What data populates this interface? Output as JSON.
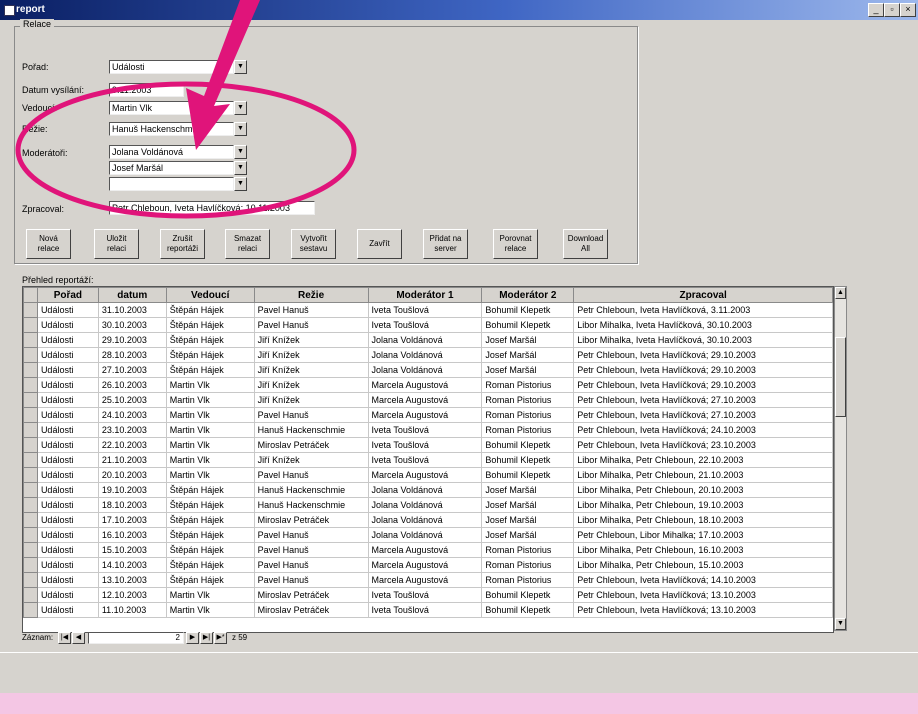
{
  "window": {
    "title": "report",
    "min_label": "_",
    "max_label": "▫",
    "close_label": "×"
  },
  "form": {
    "group_title": "Relace",
    "fields": {
      "porad_label": "Pořad:",
      "porad_value": "Události",
      "datum_label": "Datum vysílání:",
      "datum_value": "9.11.2003",
      "vedouci_label": "Vedoucí:",
      "vedouci_value": "Martin Vlk",
      "rezie_label": "Režie:",
      "rezie_value": "Hanuš Hackenschmied",
      "moderatori_label": "Moderátoři:",
      "moderator1_value": "Jolana Voldánová",
      "moderator2_value": "Josef Maršál",
      "moderator3_value": "",
      "zpracoval_label": "Zpracoval:",
      "zpracoval_value": "Petr Chleboun, Iveta Havlíčková; 10.11.2003"
    },
    "buttons": [
      "Nová\nrelace",
      "Uložit\nrelaci",
      "Zrušit\nreportáži",
      "Smazat\nrelaci",
      "Vytvořit\nsestavu",
      "Zavřít",
      "Přidat na\nserver",
      "Porovnat\nrelace",
      "Download\nAll"
    ]
  },
  "list": {
    "label": "Přehled reportáží:",
    "columns": [
      "Pořad",
      "datum",
      "Vedoucí",
      "Režie",
      "Moderátor 1",
      "Moderátor 2",
      "Zpracoval"
    ],
    "rows": [
      [
        "Události",
        "31.10.2003",
        "Štěpán Hájek",
        "Pavel Hanuš",
        "Iveta Toušlová",
        "Bohumil Klepetk",
        "Petr Chleboun, Iveta Havlíčková, 3.11.2003"
      ],
      [
        "Události",
        "30.10.2003",
        "Štěpán Hájek",
        "Pavel Hanuš",
        "Iveta Toušlová",
        "Bohumil Klepetk",
        "Libor Mihalka, Iveta Havlíčková, 30.10.2003"
      ],
      [
        "Události",
        "29.10.2003",
        "Štěpán Hájek",
        "Jiří Knížek",
        "Jolana Voldánová",
        "Josef Maršál",
        "Libor Mihalka, Iveta Havlíčková, 30.10.2003"
      ],
      [
        "Události",
        "28.10.2003",
        "Štěpán Hájek",
        "Jiří Knížek",
        "Jolana Voldánová",
        "Josef Maršál",
        "Petr Chleboun, Iveta Havlíčková; 29.10.2003"
      ],
      [
        "Události",
        "27.10.2003",
        "Štěpán Hájek",
        "Jiří Knížek",
        "Jolana Voldánová",
        "Josef Maršál",
        "Petr Chleboun, Iveta Havlíčková; 29.10.2003"
      ],
      [
        "Události",
        "26.10.2003",
        "Martin Vlk",
        "Jiří Knížek",
        "Marcela Augustová",
        "Roman Pistorius",
        "Petr Chleboun, Iveta Havlíčková; 29.10.2003"
      ],
      [
        "Události",
        "25.10.2003",
        "Martin Vlk",
        "Jiří Knížek",
        "Marcela Augustová",
        "Roman Pistorius",
        "Petr Chleboun, Iveta Havlíčková; 27.10.2003"
      ],
      [
        "Události",
        "24.10.2003",
        "Martin Vlk",
        "Pavel Hanuš",
        "Marcela Augustová",
        "Roman Pistorius",
        "Petr Chleboun, Iveta Havlíčková; 27.10.2003"
      ],
      [
        "Události",
        "23.10.2003",
        "Martin Vlk",
        "Hanuš Hackenschmie",
        "Iveta Toušlová",
        "Roman Pistorius",
        "Petr Chleboun, Iveta Havlíčková; 24.10.2003"
      ],
      [
        "Události",
        "22.10.2003",
        "Martin Vlk",
        "Miroslav Petráček",
        "Iveta Toušlová",
        "Bohumil Klepetk",
        "Petr Chleboun, Iveta Havlíčková; 23.10.2003"
      ],
      [
        "Události",
        "21.10.2003",
        "Martin Vlk",
        "Jiří Knížek",
        "Iveta Toušlová",
        "Bohumil Klepetk",
        "Libor Mihalka, Petr Chleboun, 22.10.2003"
      ],
      [
        "Události",
        "20.10.2003",
        "Martin Vlk",
        "Pavel Hanuš",
        "Marcela Augustová",
        "Bohumil Klepetk",
        "Libor Mihalka, Petr Chleboun, 21.10.2003"
      ],
      [
        "Události",
        "19.10.2003",
        "Štěpán Hájek",
        "Hanuš Hackenschmie",
        "Jolana Voldánová",
        "Josef Maršál",
        "Libor Mihalka, Petr Chleboun, 20.10.2003"
      ],
      [
        "Události",
        "18.10.2003",
        "Štěpán Hájek",
        "Hanuš Hackenschmie",
        "Jolana Voldánová",
        "Josef Maršál",
        "Libor Mihalka, Petr Chleboun, 19.10.2003"
      ],
      [
        "Události",
        "17.10.2003",
        "Štěpán Hájek",
        "Miroslav Petráček",
        "Jolana Voldánová",
        "Josef Maršál",
        "Libor Mihalka, Petr Chleboun, 18.10.2003"
      ],
      [
        "Události",
        "16.10.2003",
        "Štěpán Hájek",
        "Pavel Hanuš",
        "Jolana Voldánová",
        "Josef Maršál",
        "Petr Chleboun, Libor Mihalka; 17.10.2003"
      ],
      [
        "Události",
        "15.10.2003",
        "Štěpán Hájek",
        "Pavel Hanuš",
        "Marcela Augustová",
        "Roman Pistorius",
        "Libor Mihalka, Petr Chleboun, 16.10.2003"
      ],
      [
        "Události",
        "14.10.2003",
        "Štěpán Hájek",
        "Pavel Hanuš",
        "Marcela Augustová",
        "Roman Pistorius",
        "Libor Mihalka, Petr Chleboun, 15.10.2003"
      ],
      [
        "Události",
        "13.10.2003",
        "Štěpán Hájek",
        "Pavel Hanuš",
        "Marcela Augustová",
        "Roman Pistorius",
        "Petr Chleboun, Iveta Havlíčková; 14.10.2003"
      ],
      [
        "Události",
        "12.10.2003",
        "Martin Vlk",
        "Miroslav Petráček",
        "Iveta Toušlová",
        "Bohumil Klepetk",
        "Petr Chleboun, Iveta Havlíčková; 13.10.2003"
      ],
      [
        "Události",
        "11.10.2003",
        "Martin Vlk",
        "Miroslav Petráček",
        "Iveta Toušlová",
        "Bohumil Klepetk",
        "Petr Chleboun, Iveta Havlíčková; 13.10.2003"
      ]
    ]
  },
  "navigation": {
    "label": "Záznam:",
    "current": "2",
    "total_text": "z 59"
  },
  "colors": {
    "annotation": "#e0147a",
    "frame_background": "#f4c6e4",
    "title_bar": "#0a1f63"
  }
}
